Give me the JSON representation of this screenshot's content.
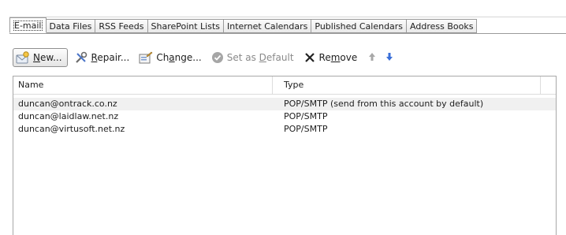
{
  "tabs": [
    {
      "label": "E-mail",
      "active": true
    },
    {
      "label": "Data Files",
      "active": false
    },
    {
      "label": "RSS Feeds",
      "active": false
    },
    {
      "label": "SharePoint Lists",
      "active": false
    },
    {
      "label": "Internet Calendars",
      "active": false
    },
    {
      "label": "Published Calendars",
      "active": false
    },
    {
      "label": "Address Books",
      "active": false
    }
  ],
  "toolbar": {
    "new_pre": "N",
    "new_ul": "",
    "new_post": "ew...",
    "repair_ul": "R",
    "repair_post": "epair...",
    "change_pre": "Ch",
    "change_ul": "a",
    "change_post": "nge...",
    "default_pre": "Set as ",
    "default_ul": "D",
    "default_post": "efault",
    "remove_pre": "Re",
    "remove_ul": "m",
    "remove_post": "ove",
    "colors": {
      "up_arrow": "#a8a8a8",
      "down_arrow": "#3a6fd8",
      "default_check": "#9a9a9a"
    }
  },
  "list": {
    "columns": [
      "Name",
      "Type"
    ],
    "rows": [
      {
        "name": "duncan@ontrack.co.nz",
        "type": "POP/SMTP (send from this account by default)",
        "selected": true
      },
      {
        "name": "duncan@laidlaw.net.nz",
        "type": "POP/SMTP",
        "selected": false
      },
      {
        "name": "duncan@virtusoft.net.nz",
        "type": "POP/SMTP",
        "selected": false
      }
    ]
  }
}
